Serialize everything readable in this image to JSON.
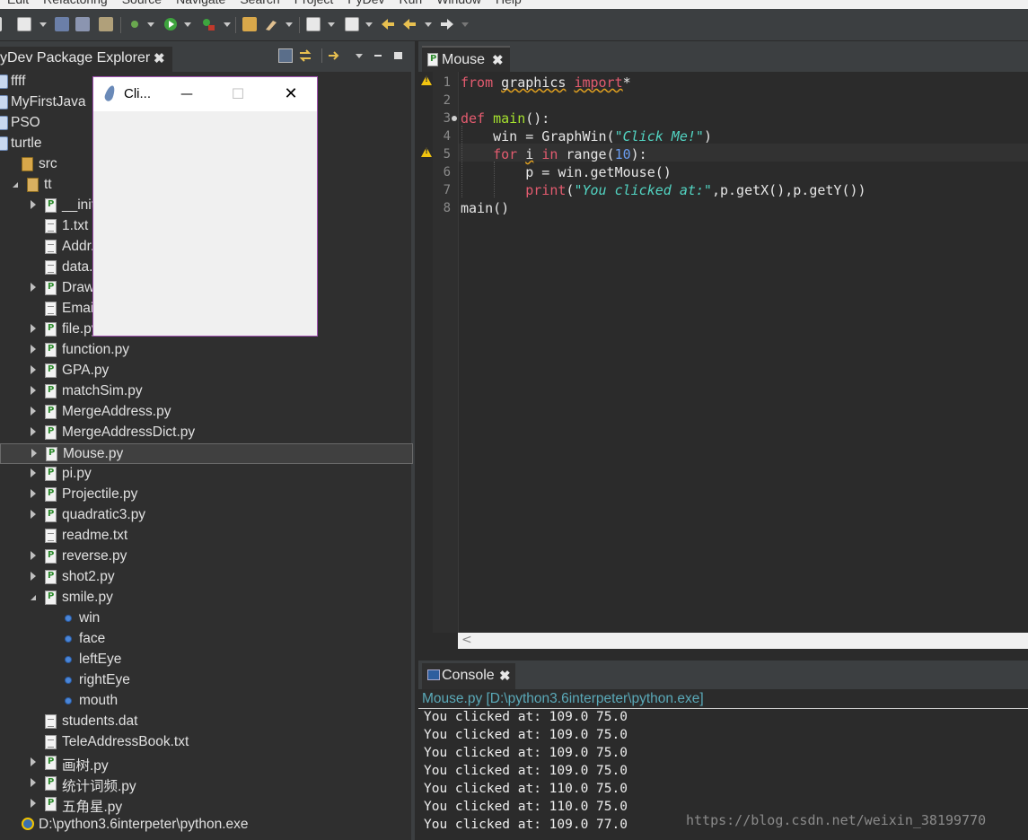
{
  "menu": {
    "items": [
      "Edit",
      "Refactoring",
      "Source",
      "Navigate",
      "Search",
      "Project",
      "PyDev",
      "Run",
      "Window",
      "Help"
    ]
  },
  "toolbar": {
    "icons": [
      "new-file-icon",
      "save-icon",
      "save-all-icon",
      "print-icon",
      "debug-icon",
      "run-icon",
      "external-tools-icon",
      "open-folder-icon",
      "brush-icon",
      "annotation-icon",
      "next-annotation-icon",
      "back-icon",
      "forward-icon"
    ]
  },
  "package_explorer": {
    "title": "yDev Package Explorer",
    "close_glyph": "✖",
    "tree": [
      {
        "label": "ffff",
        "icon": "project-icon",
        "indent": 0,
        "twisty": "none"
      },
      {
        "label": "MyFirstJava",
        "icon": "project-icon",
        "indent": 0,
        "twisty": "none"
      },
      {
        "label": "PSO",
        "icon": "project-icon",
        "indent": 0,
        "twisty": "none"
      },
      {
        "label": "turtle",
        "icon": "project-icon",
        "indent": 0,
        "twisty": "none"
      },
      {
        "label": "src",
        "icon": "source-folder-icon",
        "indent": 1,
        "twisty": "none"
      },
      {
        "label": "tt",
        "icon": "package-icon",
        "indent": 2,
        "twisty": "open"
      },
      {
        "label": "__init__.py",
        "icon": "python-file-icon",
        "indent": 3,
        "twisty": "closed"
      },
      {
        "label": "1.txt",
        "icon": "text-file-icon",
        "indent": 3,
        "twisty": "none"
      },
      {
        "label": "Addr...",
        "icon": "text-file-icon",
        "indent": 3,
        "twisty": "none"
      },
      {
        "label": "data...",
        "icon": "text-file-icon",
        "indent": 3,
        "twisty": "none"
      },
      {
        "label": "Draw...",
        "icon": "python-file-icon",
        "indent": 3,
        "twisty": "closed"
      },
      {
        "label": "Emai...",
        "icon": "text-file-icon",
        "indent": 3,
        "twisty": "none"
      },
      {
        "label": "file.py",
        "icon": "python-file-icon",
        "indent": 3,
        "twisty": "closed"
      },
      {
        "label": "function.py",
        "icon": "python-file-icon",
        "indent": 3,
        "twisty": "closed"
      },
      {
        "label": "GPA.py",
        "icon": "python-file-icon",
        "indent": 3,
        "twisty": "closed"
      },
      {
        "label": "matchSim.py",
        "icon": "python-file-icon",
        "indent": 3,
        "twisty": "closed"
      },
      {
        "label": "MergeAddress.py",
        "icon": "python-file-icon",
        "indent": 3,
        "twisty": "closed"
      },
      {
        "label": "MergeAddressDict.py",
        "icon": "python-file-icon",
        "indent": 3,
        "twisty": "closed"
      },
      {
        "label": "Mouse.py",
        "icon": "python-file-icon",
        "indent": 3,
        "twisty": "closed",
        "selected": true
      },
      {
        "label": "pi.py",
        "icon": "python-file-icon",
        "indent": 3,
        "twisty": "closed"
      },
      {
        "label": "Projectile.py",
        "icon": "python-file-icon",
        "indent": 3,
        "twisty": "closed"
      },
      {
        "label": "quadratic3.py",
        "icon": "python-file-icon",
        "indent": 3,
        "twisty": "closed"
      },
      {
        "label": "readme.txt",
        "icon": "text-file-icon",
        "indent": 3,
        "twisty": "none"
      },
      {
        "label": "reverse.py",
        "icon": "python-file-icon",
        "indent": 3,
        "twisty": "closed"
      },
      {
        "label": "shot2.py",
        "icon": "python-file-icon",
        "indent": 3,
        "twisty": "closed"
      },
      {
        "label": "smile.py",
        "icon": "python-file-icon",
        "indent": 3,
        "twisty": "open"
      },
      {
        "label": "win",
        "icon": "variable-icon",
        "indent": 4,
        "twisty": "none"
      },
      {
        "label": "face",
        "icon": "variable-icon",
        "indent": 4,
        "twisty": "none"
      },
      {
        "label": "leftEye",
        "icon": "variable-icon",
        "indent": 4,
        "twisty": "none"
      },
      {
        "label": "rightEye",
        "icon": "variable-icon",
        "indent": 4,
        "twisty": "none"
      },
      {
        "label": "mouth",
        "icon": "variable-icon",
        "indent": 4,
        "twisty": "none"
      },
      {
        "label": "students.dat",
        "icon": "text-file-icon",
        "indent": 3,
        "twisty": "none"
      },
      {
        "label": "TeleAddressBook.txt",
        "icon": "text-file-icon",
        "indent": 3,
        "twisty": "none"
      },
      {
        "label": "画树.py",
        "icon": "python-file-icon",
        "indent": 3,
        "twisty": "closed"
      },
      {
        "label": "统计词频.py",
        "icon": "python-file-icon",
        "indent": 3,
        "twisty": "closed"
      },
      {
        "label": "五角星.py",
        "icon": "python-file-icon",
        "indent": 3,
        "twisty": "closed"
      },
      {
        "label": "D:\\python3.6interpeter\\python.exe",
        "icon": "python-interpreter-icon",
        "indent": 1,
        "twisty": "none"
      }
    ]
  },
  "floating_window": {
    "title": "Cli...",
    "minimize_glyph": "—",
    "maximize_glyph": "☐",
    "close_glyph": "✕"
  },
  "editor": {
    "tab_label": "Mouse",
    "close_glyph": "✖",
    "line_numbers": [
      "1",
      "2",
      "3",
      "4",
      "5",
      "6",
      "7",
      "8"
    ],
    "warnings_on_lines": [
      1,
      5
    ],
    "current_line": 5,
    "code_lines": [
      "from graphics import*",
      "",
      "def main():",
      "    win = GraphWin(\"Click Me!\")",
      "    for i in range(10):",
      "        p = win.getMouse()",
      "        print(\"You clicked at:\",p.getX(),p.getY())",
      "main()"
    ],
    "scroll_left_glyph": "<"
  },
  "console": {
    "tab_label": "Console",
    "close_glyph": "✖",
    "header": "Mouse.py [D:\\python3.6interpeter\\python.exe]",
    "output": [
      "You clicked at: 109.0 75.0",
      "You clicked at: 109.0 75.0",
      "You clicked at: 109.0 75.0",
      "You clicked at: 109.0 75.0",
      "You clicked at: 110.0 75.0",
      "You clicked at: 110.0 75.0",
      "You clicked at: 109.0 77.0"
    ]
  },
  "watermark": "https://blog.csdn.net/weixin_38199770"
}
